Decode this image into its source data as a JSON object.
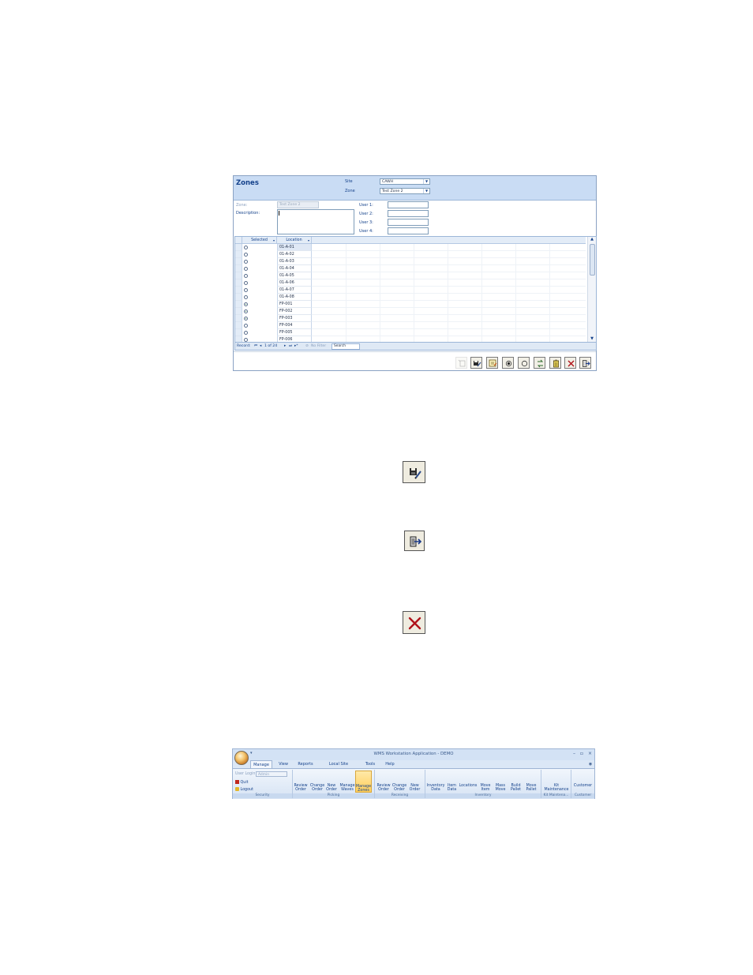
{
  "zones_form": {
    "title": "Zones",
    "site_label": "Site",
    "site_value": "CAWH",
    "zone_label": "Zone",
    "zone_value": "Test Zone 2",
    "zone_field_label": "Zone:",
    "zone_field_value": "Test Zone 2",
    "description_label": "Description:",
    "user_labels": [
      "User 1:",
      "User 2:",
      "User 3:",
      "User 4:"
    ],
    "grid": {
      "columns": [
        "Selected",
        "Location"
      ],
      "rows": [
        {
          "location": "01-A-01",
          "selected": false
        },
        {
          "location": "01-A-02",
          "selected": false
        },
        {
          "location": "01-A-03",
          "selected": false
        },
        {
          "location": "01-A-04",
          "selected": false
        },
        {
          "location": "01-A-05",
          "selected": false
        },
        {
          "location": "01-A-06",
          "selected": false
        },
        {
          "location": "01-A-07",
          "selected": false
        },
        {
          "location": "01-A-08",
          "selected": false
        },
        {
          "location": "FP-001",
          "selected": true
        },
        {
          "location": "FP-002",
          "selected": true
        },
        {
          "location": "FP-003",
          "selected": true
        },
        {
          "location": "FP-004",
          "selected": false
        },
        {
          "location": "FP-005",
          "selected": false
        },
        {
          "location": "FP-006",
          "selected": false
        }
      ]
    },
    "record_nav": {
      "record_label": "Record:",
      "position": "1 of 24",
      "filter_label": "No Filter",
      "search_label": "Search"
    },
    "toolbar_icons": [
      "new-record-icon",
      "save-icon",
      "edit-icon",
      "select-all-icon",
      "clear-all-icon",
      "swap-icon",
      "delete-icon",
      "cancel-icon",
      "exit-icon"
    ]
  },
  "ribbon": {
    "window_title": "WMS Workstation Application - DEMO",
    "tabs": [
      "Manage",
      "View",
      "Reports",
      "Local Site Settings",
      "Tools",
      "Help"
    ],
    "security": {
      "login_label": "User Login",
      "login_value": "Admin",
      "quit_label": "Quit",
      "logout_label": "Logout",
      "group_label": "Security"
    },
    "picking": {
      "commands": [
        [
          "Review",
          "Order"
        ],
        [
          "Change",
          "Order"
        ],
        [
          "New",
          "Order"
        ],
        [
          "Manage",
          "Waves"
        ],
        [
          "Manage",
          "Zones"
        ]
      ],
      "group_label": "Picking"
    },
    "receiving": {
      "commands": [
        [
          "Review",
          "Order"
        ],
        [
          "Change",
          "Order"
        ],
        [
          "New",
          "Order"
        ]
      ],
      "group_label": "Receiving"
    },
    "inventory": {
      "commands": [
        [
          "Inventory",
          "Data"
        ],
        [
          "Item",
          "Data"
        ],
        [
          "Locations",
          ""
        ],
        [
          "Move",
          "Item"
        ],
        [
          "Mass",
          "Move"
        ],
        [
          "Build",
          "Pallet"
        ],
        [
          "Move",
          "Pallet"
        ]
      ],
      "group_label": "Inventory"
    },
    "kit": {
      "commands": [
        [
          "Kit",
          "Maintenance"
        ]
      ],
      "group_label": "Kit Maintena..."
    },
    "customer": {
      "commands": [
        [
          "Customer",
          ""
        ]
      ],
      "group_label": "Customer"
    }
  },
  "colors": {
    "header_bg": "#c9dcf4",
    "accent": "#15428b",
    "ribbon_highlight": "#ffcf5a"
  }
}
